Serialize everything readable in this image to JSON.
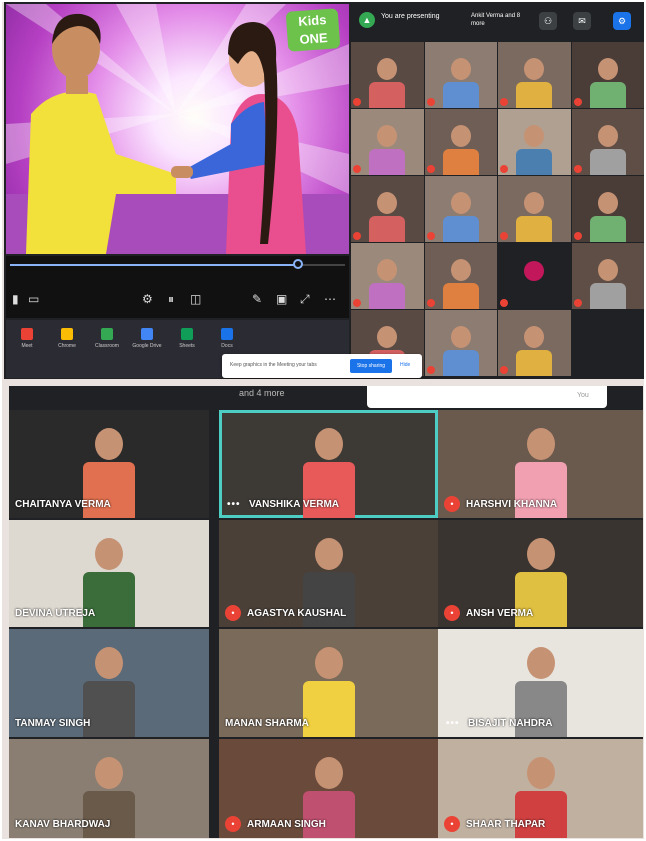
{
  "presenting": {
    "video": {
      "logo_line1": "Kids",
      "logo_line2": "ONE",
      "progress": 0.86
    },
    "meet_bar": {
      "presenting_text": "You are presenting",
      "people_text": "Ankit Verma and 8 more",
      "icons": [
        "people-icon",
        "chat-icon",
        "activities-icon"
      ]
    },
    "toast": {
      "text": "Keep graphics in the Meeting your tabs",
      "primary": "Stop sharing",
      "secondary": "Hide"
    },
    "tray_apps": [
      "Meet",
      "Chrome",
      "Classroom",
      "Google Drive",
      "Sheets",
      "Docs"
    ]
  },
  "gallery": {
    "header_more": "and 4 more",
    "card_items": [
      "",
      "",
      "",
      "You"
    ],
    "tiles": [
      {
        "name": "CHAITANYA VERMA",
        "status": "plain",
        "active": false
      },
      {
        "name": "VANSHIKA VERMA",
        "status": "dots",
        "active": true
      },
      {
        "name": "HARSHVI KHANNA",
        "status": "muted",
        "active": false
      },
      {
        "name": "DEVINA UTREJA",
        "status": "plain",
        "active": false
      },
      {
        "name": "AGASTYA KAUSHAL",
        "status": "muted",
        "active": false
      },
      {
        "name": "ANSH VERMA",
        "status": "muted",
        "active": false
      },
      {
        "name": "TANMAY SINGH",
        "status": "plain",
        "active": false
      },
      {
        "name": "MANAN SHARMA",
        "status": "plain",
        "active": false
      },
      {
        "name": "BISAJIT NAHDRA",
        "status": "dots",
        "active": false
      },
      {
        "name": "KANAV BHARDWAJ",
        "status": "plain",
        "active": false
      },
      {
        "name": "ARMAAN SINGH",
        "status": "muted",
        "active": false
      },
      {
        "name": "SHAAR THAPAR",
        "status": "muted",
        "active": false
      }
    ]
  },
  "colors": {
    "meet_dark": "#202124",
    "tile_bg": "#3c4043",
    "muted_red": "#ea4335",
    "active_outline": "#4ecdc4",
    "present_green": "#34a853"
  }
}
